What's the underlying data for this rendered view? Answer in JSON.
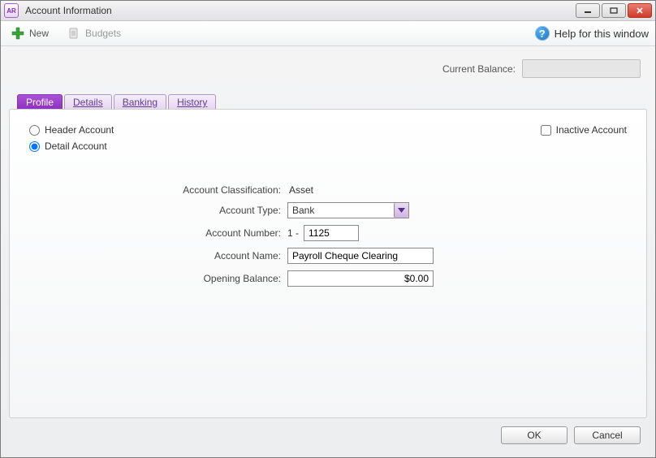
{
  "window": {
    "app_icon_text": "AR",
    "title": "Account Information"
  },
  "toolbar": {
    "new_label": "New",
    "budgets_label": "Budgets",
    "help_label": "Help for this window"
  },
  "balance": {
    "label": "Current Balance:",
    "value": ""
  },
  "tabs": {
    "profile": "Profile",
    "details": "Details",
    "banking": "Banking",
    "history": "History",
    "active": "profile"
  },
  "profile": {
    "header_account_label": "Header Account",
    "detail_account_label": "Detail Account",
    "inactive_label": "Inactive Account",
    "classification_label": "Account Classification:",
    "classification_value": "Asset",
    "type_label": "Account Type:",
    "type_value": "Bank",
    "number_label": "Account Number:",
    "number_prefix": "1 -",
    "number_value": "1125",
    "name_label": "Account Name:",
    "name_value": "Payroll Cheque Clearing",
    "opening_label": "Opening Balance:",
    "opening_value": "$0.00"
  },
  "buttons": {
    "ok": "OK",
    "cancel": "Cancel"
  }
}
